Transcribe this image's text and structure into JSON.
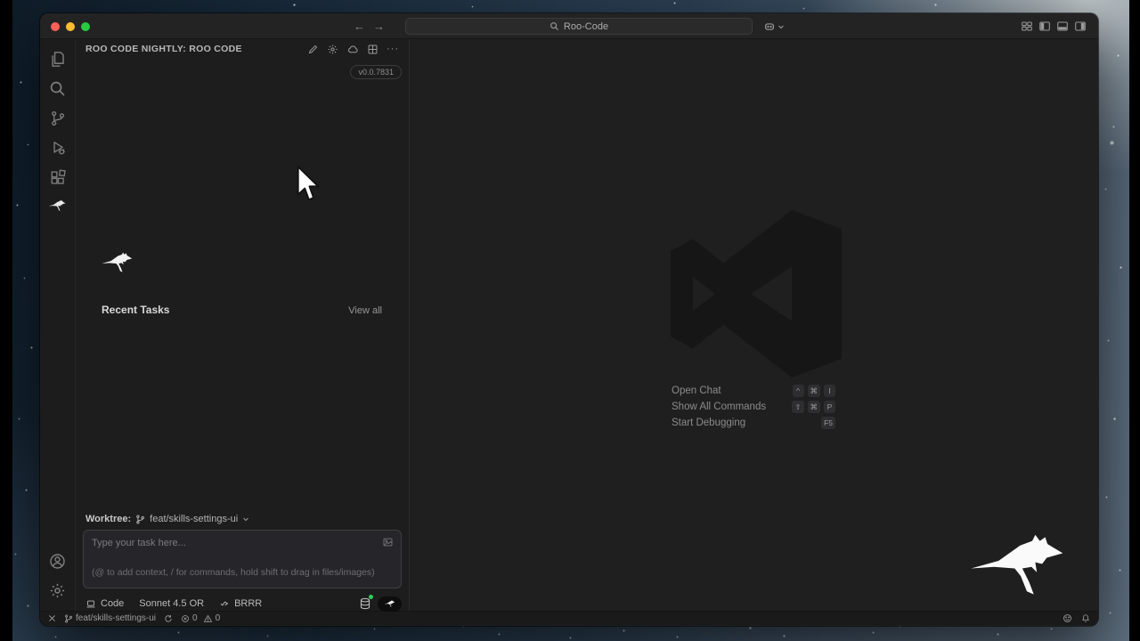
{
  "titlebar": {
    "back_arrow": "←",
    "forward_arrow": "→",
    "search_value": "Roo-Code"
  },
  "panel": {
    "title": "ROO CODE NIGHTLY: ROO CODE",
    "more_label": "···",
    "version": "v0.0.7831",
    "recent_tasks": "Recent Tasks",
    "view_all": "View all",
    "worktree_label": "Worktree:",
    "worktree_branch": "feat/skills-settings-ui",
    "input_placeholder": "Type your task here...",
    "input_hint": "(@ to add context, / for commands, hold shift to drag in files/images)",
    "mode": "Code",
    "model": "Sonnet 4.5 OR",
    "auto_label": "BRRR"
  },
  "editor": {
    "shortcuts": [
      {
        "label": "Open Chat",
        "keys": [
          "^",
          "⌘",
          "I"
        ]
      },
      {
        "label": "Show All Commands",
        "keys": [
          "⇧",
          "⌘",
          "P"
        ]
      },
      {
        "label": "Start Debugging",
        "keys": [
          "F5"
        ]
      }
    ]
  },
  "statusbar": {
    "branch": "feat/skills-settings-ui",
    "error_count": "0",
    "warning_count": "0"
  },
  "colors": {
    "traffic_red": "#ff5f57",
    "traffic_yellow": "#febc2e",
    "traffic_green": "#28c840",
    "badge_green": "#2ecc5e",
    "window_bg": "#1e1e1e"
  },
  "icons": {
    "activity_bar": [
      "explorer-icon",
      "search-icon",
      "source-control-icon",
      "run-debug-icon",
      "extensions-icon",
      "roo-kangaroo-icon"
    ],
    "activity_bar_bottom": [
      "account-icon",
      "settings-gear-icon"
    ],
    "panel_header": [
      "new-task-pencil-icon",
      "settings-gear-icon",
      "cloud-icon",
      "marketplace-icon",
      "more-ellipsis"
    ]
  }
}
